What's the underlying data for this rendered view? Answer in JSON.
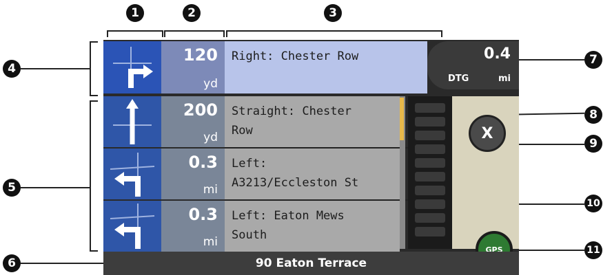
{
  "callouts": [
    "1",
    "2",
    "3",
    "4",
    "5",
    "6",
    "7",
    "8",
    "9",
    "10",
    "11"
  ],
  "current_turn": {
    "distance": "120",
    "unit": "yd",
    "instruction": "Right: Chester Row",
    "arrow": "turn-right-icon"
  },
  "upcoming": [
    {
      "distance": "200",
      "unit": "yd",
      "line1": "Straight: Chester",
      "line2": "Row",
      "arrow": "straight-icon"
    },
    {
      "distance": "0.3",
      "unit": "mi",
      "line1": "Left:",
      "line2": "A3213/Eccleston St",
      "arrow": "turn-left-icon"
    },
    {
      "distance": "0.3",
      "unit": "mi",
      "line1": "Left: Eaton Mews",
      "line2": "South",
      "arrow": "turn-left-icon"
    }
  ],
  "dtg": {
    "value": "0.4",
    "label": "DTG",
    "unit": "mi"
  },
  "close_label": "X",
  "gps_label": "GPS",
  "status": {
    "street": "90 Eaton Terrace"
  }
}
